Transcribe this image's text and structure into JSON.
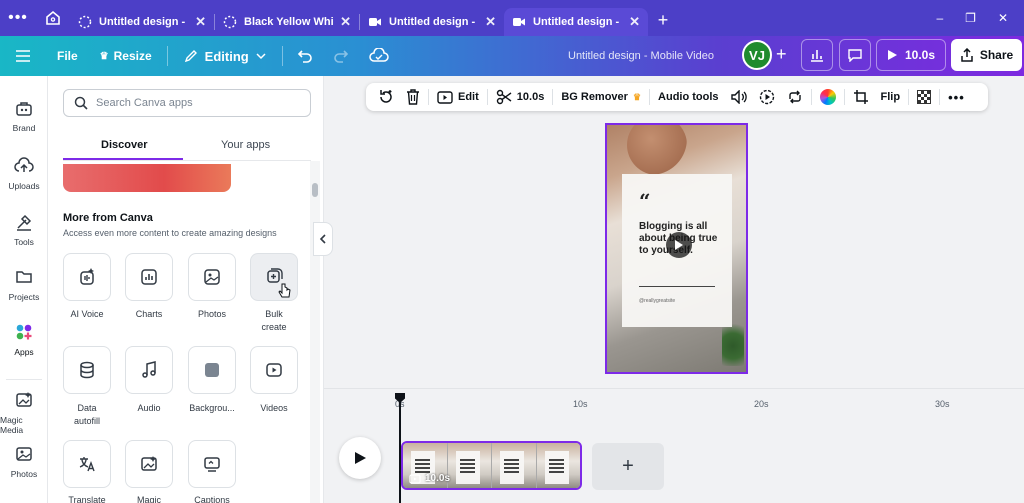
{
  "browser": {
    "tabs": [
      {
        "title": "Untitled design - M...",
        "icon": "canva-dotted-circle-icon"
      },
      {
        "title": "Black Yellow White...",
        "icon": "canva-dotted-circle-icon"
      },
      {
        "title": "Untitled design - M...",
        "icon": "canva-video-icon"
      },
      {
        "title": "Untitled design - M...",
        "icon": "canva-video-icon",
        "active": true
      }
    ],
    "new_tab": "+",
    "window_controls": [
      "–",
      "❐",
      "✕"
    ]
  },
  "header": {
    "file": "File",
    "resize": "Resize",
    "editing": "Editing",
    "doc_title": "Untitled design - Mobile Video",
    "avatar_initials": "VJ",
    "add_collaborator": "+",
    "play_duration": "10.0s",
    "share": "Share"
  },
  "rail": {
    "items": [
      {
        "label": "Brand",
        "icon": "brand-icon"
      },
      {
        "label": "Uploads",
        "icon": "upload-cloud-icon"
      },
      {
        "label": "Tools",
        "icon": "tools-icon"
      },
      {
        "label": "Projects",
        "icon": "folder-icon"
      },
      {
        "label": "Apps",
        "icon": "apps-grid-icon",
        "active": true
      },
      {
        "label": "Magic Media",
        "icon": "magic-media-icon"
      },
      {
        "label": "Photos",
        "icon": "photos-icon"
      }
    ]
  },
  "panel": {
    "search_placeholder": "Search Canva apps",
    "tabs": {
      "discover": "Discover",
      "your_apps": "Your apps"
    },
    "section_title": "More from Canva",
    "section_subtitle": "Access even more content to create amazing designs",
    "apps_row1": [
      {
        "label": "AI Voice",
        "icon": "ai-voice-icon"
      },
      {
        "label": "Charts",
        "icon": "charts-icon"
      },
      {
        "label": "Photos",
        "icon": "photos-icon"
      },
      {
        "label": "Bulk create",
        "icon": "bulk-create-icon"
      }
    ],
    "apps_row2": [
      {
        "label": "Data autofill",
        "icon": "database-icon"
      },
      {
        "label": "Audio",
        "icon": "music-note-icon"
      },
      {
        "label": "Backgrou...",
        "icon": "background-icon"
      },
      {
        "label": "Videos",
        "icon": "video-play-icon"
      }
    ],
    "apps_row3": [
      {
        "label": "Translate",
        "icon": "translate-icon"
      },
      {
        "label": "Magic",
        "icon": "magic-icon"
      },
      {
        "label": "Captions",
        "icon": "captions-icon"
      }
    ]
  },
  "toolbar": {
    "edit": "Edit",
    "split_duration": "10.0s",
    "bg_remover": "BG Remover",
    "crown": "♛",
    "audio_tools": "Audio tools",
    "flip": "Flip",
    "more": "•••"
  },
  "design": {
    "quote_mark": "“",
    "quote_text": "Blogging is all about being true to yourself.",
    "handle": "@reallygreatsite"
  },
  "timeline": {
    "ticks": [
      "0s",
      "10s",
      "20s",
      "30s"
    ],
    "clip_duration": "10.0s",
    "add_clip": "+"
  },
  "colors": {
    "accent": "#7d2ae8",
    "browser_bar": "#4c3fc7",
    "avatar": "#1f8b2e"
  }
}
